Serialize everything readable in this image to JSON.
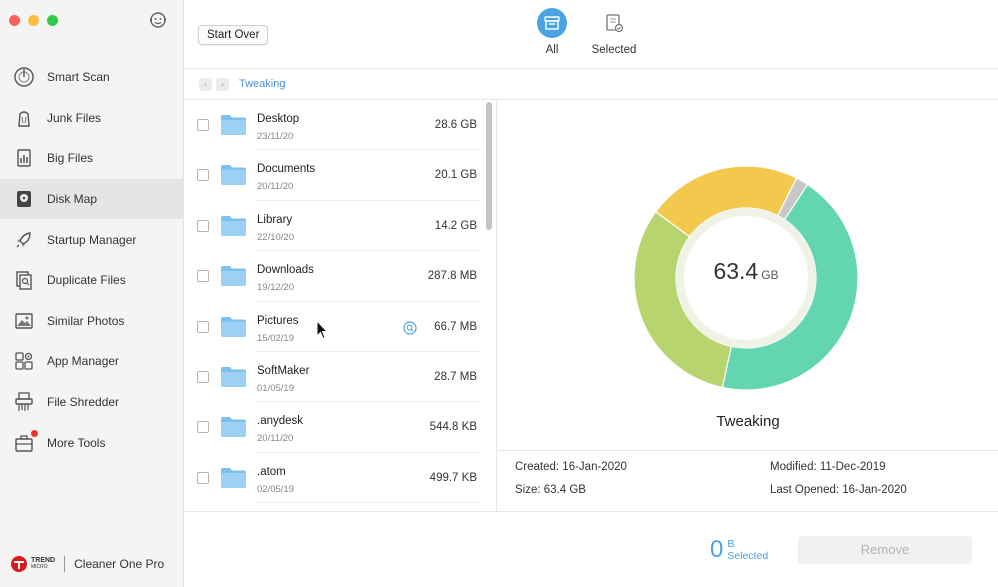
{
  "sidebar": {
    "items": [
      {
        "label": "Smart Scan",
        "icon": "smart-scan-icon"
      },
      {
        "label": "Junk Files",
        "icon": "junk-files-icon"
      },
      {
        "label": "Big Files",
        "icon": "big-files-icon"
      },
      {
        "label": "Disk Map",
        "icon": "disk-map-icon",
        "active": true
      },
      {
        "label": "Startup Manager",
        "icon": "rocket-icon"
      },
      {
        "label": "Duplicate Files",
        "icon": "duplicate-files-icon"
      },
      {
        "label": "Similar Photos",
        "icon": "photos-icon"
      },
      {
        "label": "App Manager",
        "icon": "app-manager-icon"
      },
      {
        "label": "File Shredder",
        "icon": "shredder-icon"
      },
      {
        "label": "More Tools",
        "icon": "toolbox-icon",
        "badge": true
      }
    ],
    "brand": {
      "logo_line1": "TREND",
      "logo_line2": "MICRO",
      "app_name": "Cleaner One Pro"
    }
  },
  "toolbar": {
    "start_over": "Start Over",
    "tabs": [
      {
        "label": "All",
        "active": true
      },
      {
        "label": "Selected",
        "active": false
      }
    ]
  },
  "breadcrumb": {
    "current": "Tweaking"
  },
  "files": [
    {
      "name": "Desktop",
      "date": "23/11/20",
      "size": "28.6 GB"
    },
    {
      "name": "Documents",
      "date": "20/11/20",
      "size": "20.1 GB"
    },
    {
      "name": "Library",
      "date": "22/10/20",
      "size": "14.2 GB"
    },
    {
      "name": "Downloads",
      "date": "19/12/20",
      "size": "287.8 MB"
    },
    {
      "name": "Pictures",
      "date": "15/02/19",
      "size": "66.7 MB"
    },
    {
      "name": "SoftMaker",
      "date": "01/05/19",
      "size": "28.7 MB"
    },
    {
      "name": ".anydesk",
      "date": "20/11/20",
      "size": "544.8 KB"
    },
    {
      "name": ".atom",
      "date": "02/05/19",
      "size": "499.7 KB"
    }
  ],
  "detail": {
    "total_value": "63.4",
    "total_unit": "GB",
    "folder_name": "Tweaking",
    "created": "Created: 16-Jan-2020",
    "size": "Size: 63.4 GB",
    "modified": "Modified: 11-Dec-2019",
    "last_opened": "Last Opened: 16-Jan-2020",
    "segments": [
      {
        "share": 0.451,
        "color": "#63d5b1"
      },
      {
        "share": 0.317,
        "color": "#b8d46e"
      },
      {
        "share": 0.224,
        "color": "#f2c94c"
      },
      {
        "share": 0.018,
        "color": "#c8c8c8"
      }
    ]
  },
  "footer": {
    "selected_count": "0",
    "selected_unit": "B",
    "selected_label": "Selected",
    "remove_label": "Remove"
  },
  "colors": {
    "accent": "#4aa3e3",
    "folder": "#7cc1ee"
  }
}
